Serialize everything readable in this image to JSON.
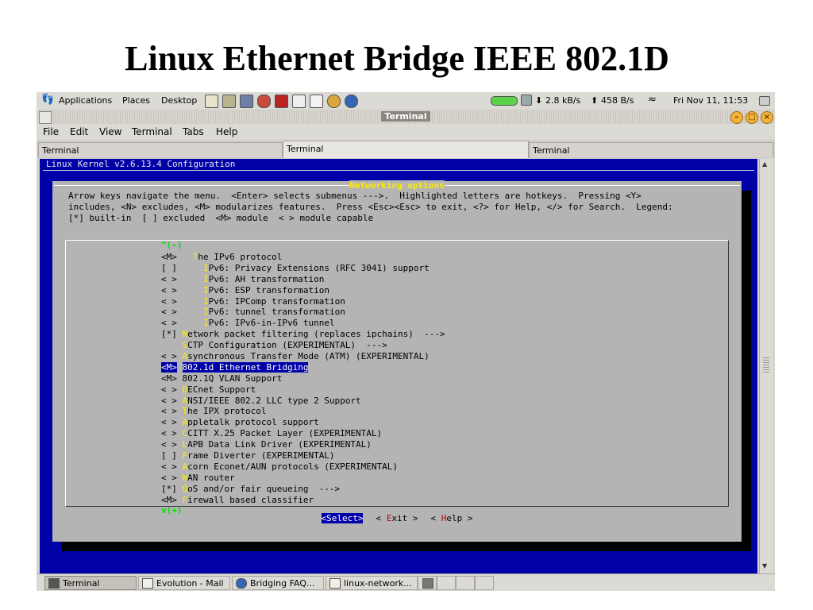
{
  "slide": {
    "title": "Linux Ethernet Bridge IEEE 802.1D"
  },
  "top_panel": {
    "menus": [
      "Applications",
      "Places",
      "Desktop"
    ],
    "net_down": "2.8 kB/s",
    "net_up": "458 B/s",
    "clock": "Fri Nov 11, 11:53"
  },
  "window": {
    "title": "Terminal",
    "menu": [
      "File",
      "Edit",
      "View",
      "Terminal",
      "Tabs",
      "Help"
    ],
    "tabs": [
      "Terminal",
      "Terminal",
      "Terminal"
    ]
  },
  "terminal": {
    "kernel_title": "Linux Kernel v2.6.13.4 Configuration",
    "dialog_title": "Networking options",
    "help_lines": [
      "Arrow keys navigate the menu.  <Enter> selects submenus --->.  Highlighted letters are hotkeys.  Pressing <Y>",
      "includes, <N> excludes, <M> modularizes features.  Press <Esc><Esc> to exit, <?> for Help, </> for Search.  Legend:",
      "[*] built-in  [ ] excluded  <M> module  < > module capable"
    ],
    "scroll_up": "^(-)",
    "scroll_down": "v(+)",
    "items": [
      {
        "state": "<M>",
        "indent": "  ",
        "hotkey": "T",
        "rest": "he IPv6 protocol"
      },
      {
        "state": "[ ]",
        "indent": "    ",
        "hotkey": "I",
        "rest": "Pv6: Privacy Extensions (RFC 3041) support"
      },
      {
        "state": "< >",
        "indent": "    ",
        "hotkey": "I",
        "rest": "Pv6: AH transformation"
      },
      {
        "state": "< >",
        "indent": "    ",
        "hotkey": "I",
        "rest": "Pv6: ESP transformation"
      },
      {
        "state": "< >",
        "indent": "    ",
        "hotkey": "I",
        "rest": "Pv6: IPComp transformation"
      },
      {
        "state": "< >",
        "indent": "    ",
        "hotkey": "I",
        "rest": "Pv6: tunnel transformation"
      },
      {
        "state": "< >",
        "indent": "    ",
        "hotkey": "I",
        "rest": "Pv6: IPv6-in-IPv6 tunnel"
      },
      {
        "state": "[*]",
        "indent": "",
        "hotkey": "N",
        "rest": "etwork packet filtering (replaces ipchains)  --->"
      },
      {
        "state": "   ",
        "indent": "",
        "hotkey": "S",
        "rest": "CTP Configuration (EXPERIMENTAL)  --->"
      },
      {
        "state": "< >",
        "indent": "",
        "hotkey": "A",
        "rest": "synchronous Transfer Mode (ATM) (EXPERIMENTAL)"
      },
      {
        "state": "<M>",
        "indent": "",
        "hotkey": "",
        "rest": "802.1d Ethernet Bridging",
        "selected": true
      },
      {
        "state": "<M>",
        "indent": "",
        "hotkey": "",
        "rest": "802.1Q VLAN Support"
      },
      {
        "state": "< >",
        "indent": "",
        "hotkey": "D",
        "rest": "ECnet Support"
      },
      {
        "state": "< >",
        "indent": "",
        "hotkey": "A",
        "rest": "NSI/IEEE 802.2 LLC type 2 Support"
      },
      {
        "state": "< >",
        "indent": "",
        "hotkey": "T",
        "rest": "he IPX protocol"
      },
      {
        "state": "< >",
        "indent": "",
        "hotkey": "A",
        "rest": "ppletalk protocol support"
      },
      {
        "state": "< >",
        "indent": "",
        "hotkey": "C",
        "rest": "CITT X.25 Packet Layer (EXPERIMENTAL)"
      },
      {
        "state": "< >",
        "indent": "",
        "hotkey": "L",
        "rest": "APB Data Link Driver (EXPERIMENTAL)"
      },
      {
        "state": "[ ]",
        "indent": "",
        "hotkey": "F",
        "rest": "rame Diverter (EXPERIMENTAL)"
      },
      {
        "state": "< >",
        "indent": "",
        "hotkey": "A",
        "rest": "corn Econet/AUN protocols (EXPERIMENTAL)"
      },
      {
        "state": "< >",
        "indent": "",
        "hotkey": "W",
        "rest": "AN router"
      },
      {
        "state": "[*]",
        "indent": "",
        "hotkey": "Q",
        "rest": "oS and/or fair queueing  --->"
      },
      {
        "state": "<M>",
        "indent": "",
        "hotkey": "F",
        "rest": "irewall based classifier"
      }
    ],
    "buttons": {
      "select": "<Select>",
      "exit_pre": "< ",
      "exit_hk": "E",
      "exit_post": "xit >",
      "help_pre": "< ",
      "help_hk": "H",
      "help_post": "elp >"
    }
  },
  "taskbar": {
    "tasks": [
      "Terminal",
      "Evolution - Mail",
      "Bridging FAQ...",
      "linux-network..."
    ]
  },
  "colors": {
    "terminal_bg": "#0000a8",
    "dialog_bg": "#b4b4b4",
    "hotkey": "#ffea00",
    "title_yellow": "#ffea00"
  }
}
